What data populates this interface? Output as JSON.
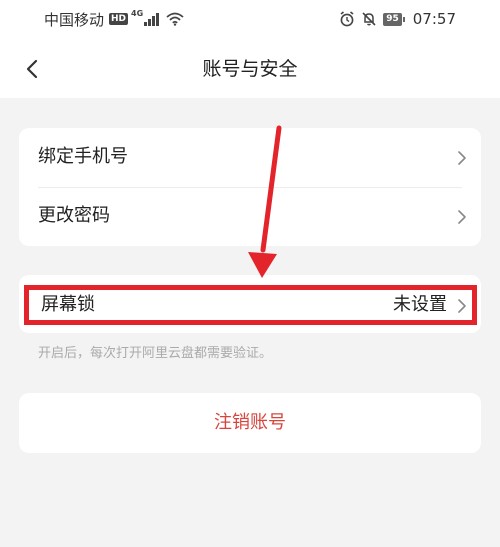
{
  "status_bar": {
    "carrier": "中国移动",
    "hd": "HD",
    "network": "4G",
    "battery": "95",
    "time": "07:57"
  },
  "nav": {
    "title": "账号与安全"
  },
  "settings": {
    "bind_phone": "绑定手机号",
    "change_password": "更改密码",
    "screen_lock_label": "屏幕锁",
    "screen_lock_value": "未设置",
    "screen_lock_hint": "开启后，每次打开阿里云盘都需要验证。",
    "delete_account": "注销账号"
  },
  "colors": {
    "annotation_red": "#e4242b",
    "danger_text": "#d8453e"
  },
  "icons": {
    "back": "chevron-left-icon",
    "row_arrow": "chevron-right-icon",
    "alarm": "alarm-icon",
    "mute": "bell-off-icon",
    "wifi": "wifi-icon"
  }
}
